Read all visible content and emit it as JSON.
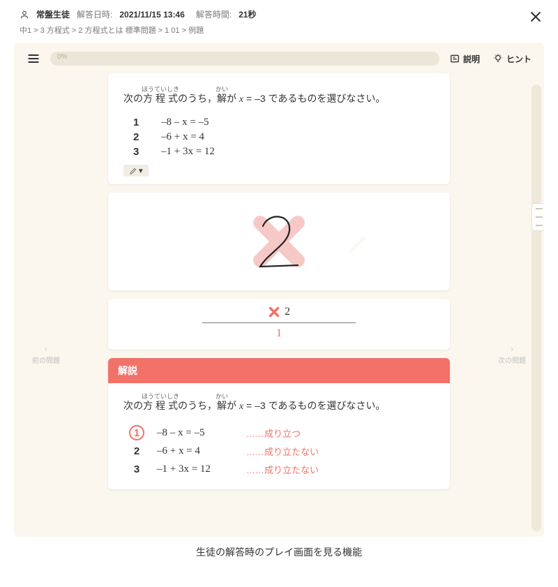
{
  "header": {
    "user_name": "常盤生徒",
    "datetime_label": "解答日時:",
    "datetime_value": "2021/11/15 13:46",
    "duration_label": "解答時間:",
    "duration_value": "21秒"
  },
  "breadcrumb": "中1 > 3 方程式 > 2 方程式とは 標準問題 > 1 01 > 例題",
  "topbar": {
    "progress_text": "0%",
    "explain_label": "説明",
    "hint_label": "ヒント"
  },
  "question": {
    "prefix": "次の",
    "ruby1_base": "方程式",
    "ruby1_read": "ほうていしき",
    "mid1": "のうち，",
    "ruby2_base": "解",
    "ruby2_read": "かい",
    "mid2": "が ",
    "expr_lhs": "x",
    "expr_eq": " = –3 ",
    "suffix": "であるものを選びなさい。",
    "choices": [
      {
        "n": "1",
        "eq": "–8 – x = –5"
      },
      {
        "n": "2",
        "eq": "–6 + x = 4"
      },
      {
        "n": "3",
        "eq": "–1 + 3x = 12"
      }
    ]
  },
  "answer_area": {
    "handwritten_value": "2"
  },
  "score": {
    "given": "2",
    "correct": "1"
  },
  "explanation": {
    "heading": "解説",
    "rows": [
      {
        "n": "1",
        "eq": "–8 – x = –5",
        "note": "……成り立つ",
        "correct": true
      },
      {
        "n": "2",
        "eq": "–6 + x = 4",
        "note": "……成り立たない",
        "correct": false
      },
      {
        "n": "3",
        "eq": "–1 + 3x = 12",
        "note": "……成り立たない",
        "correct": false
      }
    ]
  },
  "nav": {
    "prev": "前の問題",
    "next": "次の問題"
  },
  "caption": "生徒の解答時のプレイ画面を見る機能",
  "icons": {
    "user": "user-icon",
    "close": "close-icon",
    "hamburger": "hamburger-icon",
    "card": "card-icon",
    "bulb": "bulb-icon",
    "pencil": "pencil-icon",
    "wrong": "wrong-x-icon",
    "chev_left": "‹",
    "chev_right": "›"
  }
}
